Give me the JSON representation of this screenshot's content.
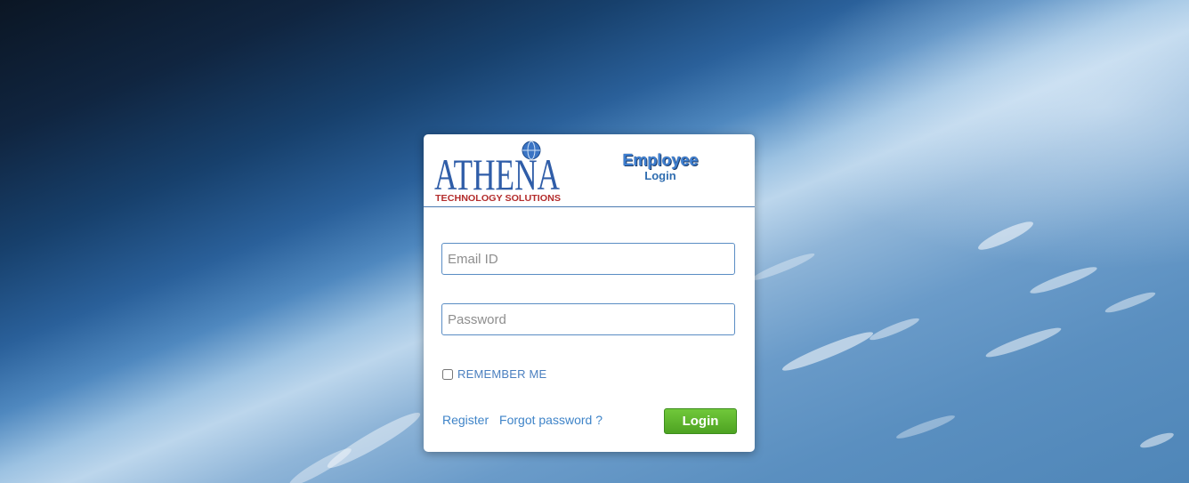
{
  "brand": {
    "logo_name": "ATHENA",
    "logo_tagline": "TECHNOLOGY SOLUTIONS",
    "logo_color": "#2f5da8",
    "tagline_color": "#b32c2c"
  },
  "header": {
    "title": "Employee",
    "subtitle": "Login"
  },
  "form": {
    "email": {
      "value": "",
      "placeholder": "Email ID"
    },
    "password": {
      "value": "",
      "placeholder": "Password"
    },
    "remember_label": "REMEMBER ME",
    "remember_checked": false,
    "register_label": "Register",
    "forgot_label": "Forgot password ?",
    "login_label": "Login"
  },
  "colors": {
    "accent": "#3d7ed0",
    "login_green": "#5bb22c",
    "link": "#3f84c8"
  }
}
